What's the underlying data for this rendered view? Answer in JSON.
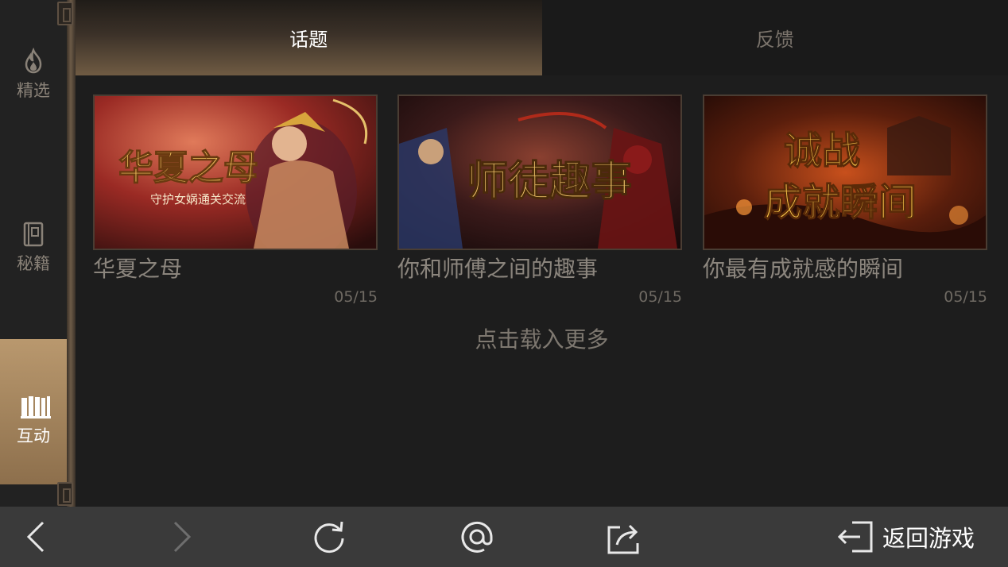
{
  "sidebar": {
    "items": [
      {
        "label": "精选",
        "icon": "flame-icon",
        "active": false
      },
      {
        "label": "秘籍",
        "icon": "book-icon",
        "active": false
      },
      {
        "label": "互动",
        "icon": "books-icon",
        "active": true
      }
    ]
  },
  "tabs": [
    {
      "label": "话题",
      "active": true
    },
    {
      "label": "反馈",
      "active": false
    }
  ],
  "topics": [
    {
      "title": "华夏之母",
      "date": "05/15",
      "banner_text": "华夏之母",
      "banner_sub": "守护女娲通关交流"
    },
    {
      "title": "你和师傅之间的趣事",
      "date": "05/15",
      "banner_text": "师徒趣事",
      "banner_sub": ""
    },
    {
      "title": "你最有成就感的瞬间",
      "date": "05/15",
      "banner_text": "诚战",
      "banner_text2": "成就瞬间",
      "banner_sub": ""
    }
  ],
  "load_more": "点击载入更多",
  "bottom_bar": {
    "back_icon": "chevron-left-icon",
    "forward_icon": "chevron-right-icon",
    "refresh_icon": "refresh-icon",
    "at_icon": "at-icon",
    "share_icon": "share-icon",
    "return_icon": "exit-icon",
    "return_label": "返回游戏"
  },
  "colors": {
    "accent": "#b9986e",
    "background": "#1d1d1d",
    "bottom_bar": "#3a3a3a"
  }
}
